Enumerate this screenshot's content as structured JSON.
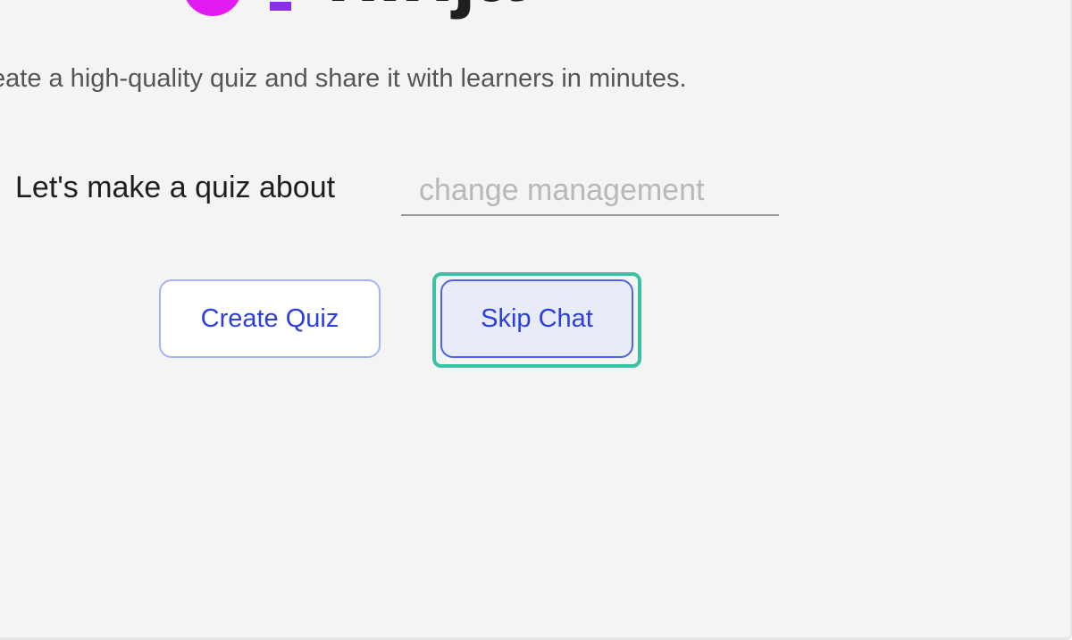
{
  "brand": {
    "wordmark": "ninja",
    "dot_color": "#e21cf0",
    "bar_color": "#8a2cf2"
  },
  "subtitle": "eate a high-quality quiz and share it with learners in minutes.",
  "prompt": {
    "label": "Let's make a quiz about",
    "input_value": "",
    "input_placeholder": "change management"
  },
  "buttons": {
    "create_quiz": "Create Quiz",
    "skip_chat": "Skip Chat"
  },
  "colors": {
    "background": "#f4f4f4",
    "button_text": "#2b3fe0",
    "focus_ring": "#3cc1a2"
  }
}
